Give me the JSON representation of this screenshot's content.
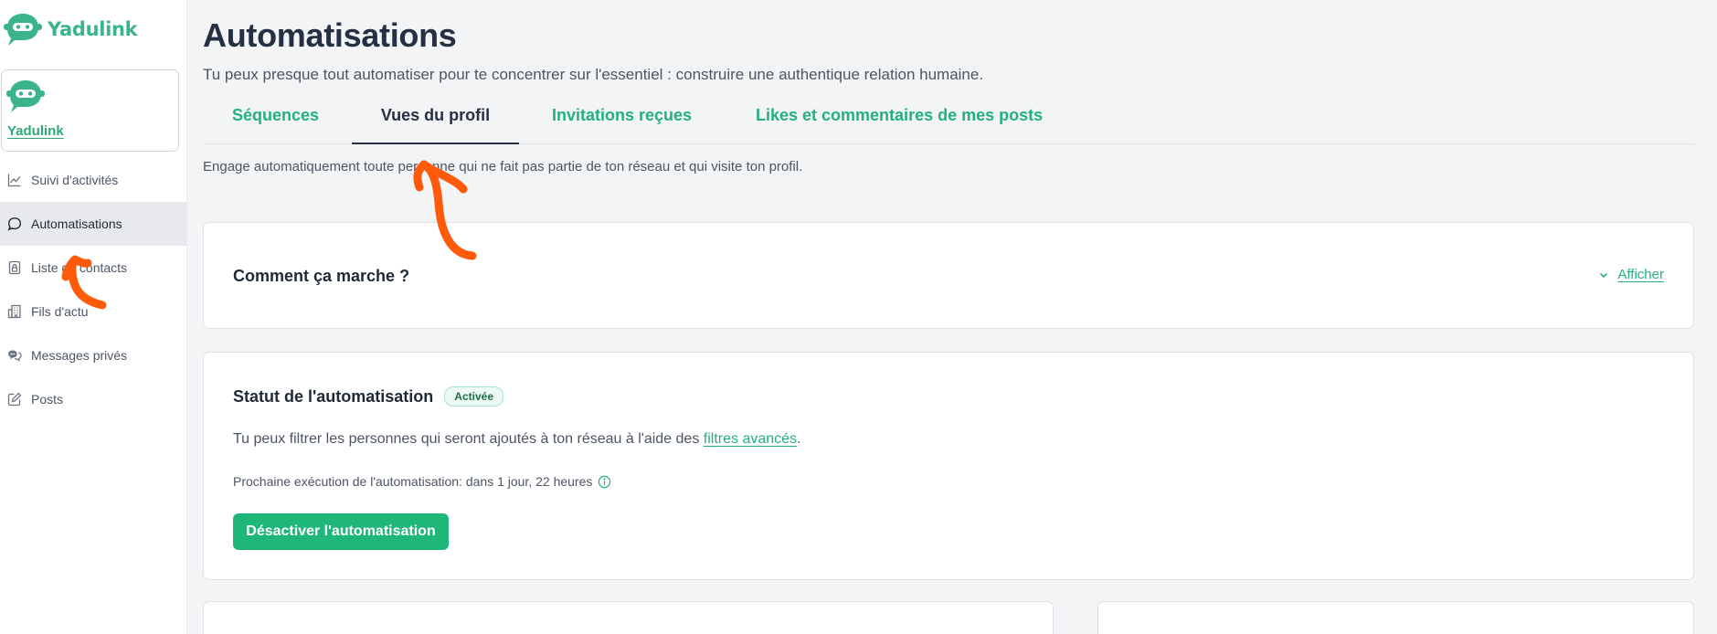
{
  "app": {
    "brand": "Yadulink",
    "brand_color": "#3cb48a"
  },
  "sidebar": {
    "account_name": "Yadulink",
    "items": [
      {
        "label": "Suivi d'activités",
        "icon": "chart-line-icon"
      },
      {
        "label": "Automatisations",
        "icon": "chat-bubble-icon",
        "active": true
      },
      {
        "label": "Liste de contacts",
        "icon": "contact-lock-icon"
      },
      {
        "label": "Fils d'actu",
        "icon": "building-icon"
      },
      {
        "label": "Messages privés",
        "icon": "messages-icon"
      },
      {
        "label": "Posts",
        "icon": "edit-icon"
      }
    ]
  },
  "header": {
    "title": "Automatisations",
    "subtitle": "Tu peux presque tout automatiser pour te concentrer sur l'essentiel : construire une authentique relation humaine."
  },
  "tabs": [
    {
      "label": "Séquences",
      "active": false
    },
    {
      "label": "Vues du profil",
      "active": true
    },
    {
      "label": "Invitations reçues",
      "active": false
    },
    {
      "label": "Likes et commentaires de mes posts",
      "active": false
    }
  ],
  "tab_description": "Engage automatiquement toute personne qui ne fait pas partie de ton réseau et qui visite ton profil.",
  "how_it_works": {
    "title": "Comment ça marche ?",
    "toggle_label": "Afficher"
  },
  "status": {
    "title": "Statut de l'automatisation",
    "badge": "Activée",
    "text_prefix": "Tu peux filtrer les personnes qui seront ajoutés à ton réseau à l'aide des ",
    "link_label": "filtres avancés",
    "text_suffix": ".",
    "next_run": "Prochaine exécution de l'automatisation: dans 1 jour, 22 heures",
    "deactivate_label": "Désactiver l'automatisation"
  },
  "colors": {
    "accent": "#23b07d",
    "button": "#1fb679",
    "annotation": "#ff5a0a"
  }
}
